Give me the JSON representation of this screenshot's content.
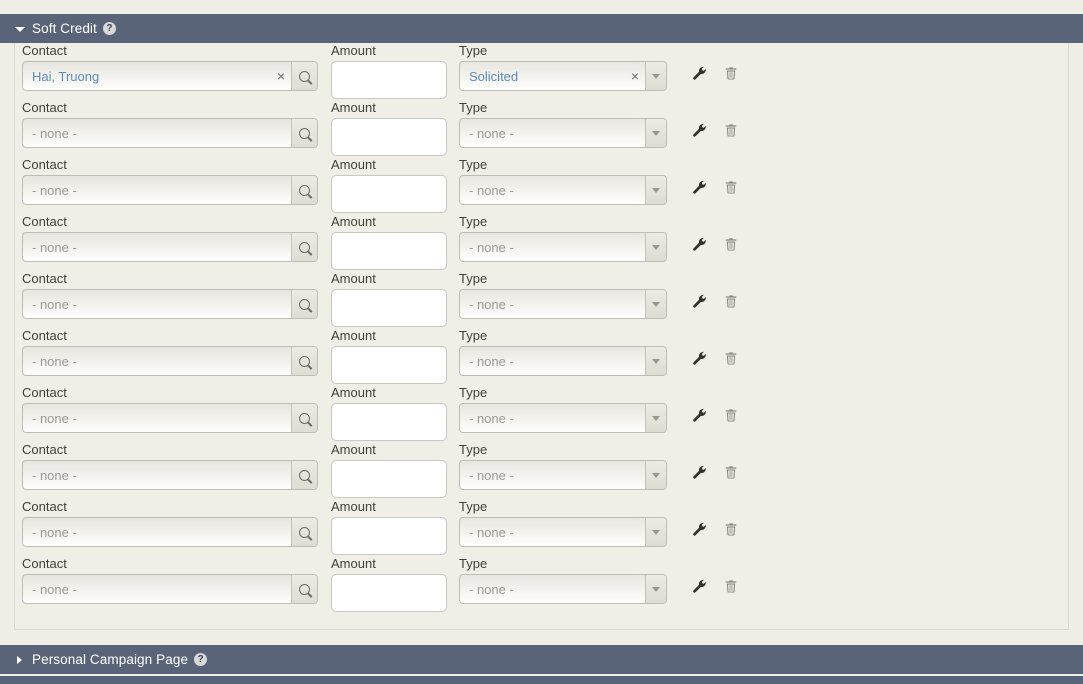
{
  "sections": {
    "soft_credit": {
      "title": "Soft Credit",
      "help": "?",
      "expanded": true
    },
    "personal_campaign_page": {
      "title": "Personal Campaign Page",
      "help": "?",
      "expanded": false
    }
  },
  "labels": {
    "contact": "Contact",
    "amount": "Amount",
    "type": "Type"
  },
  "placeholders": {
    "none": "- none -",
    "amount": ""
  },
  "icons": {
    "clear": "×",
    "search": "search-icon",
    "wrench": "wrench-icon",
    "trash": "trash-icon",
    "caret_down": "chevron-down-icon",
    "caret_right": "chevron-right-icon"
  },
  "colors": {
    "header_bar": "#5a6478",
    "page_background": "#efeee6",
    "panel_background": "#f0efe7",
    "link_text": "#5b8db8",
    "placeholder_text": "#9b9a94"
  },
  "rows": [
    {
      "contact": "Hai, Truong",
      "contact_filled": true,
      "amount": "",
      "type": "Solicited",
      "type_filled": true
    },
    {
      "contact": "- none -",
      "contact_filled": false,
      "amount": "",
      "type": "- none -",
      "type_filled": false
    },
    {
      "contact": "- none -",
      "contact_filled": false,
      "amount": "",
      "type": "- none -",
      "type_filled": false
    },
    {
      "contact": "- none -",
      "contact_filled": false,
      "amount": "",
      "type": "- none -",
      "type_filled": false
    },
    {
      "contact": "- none -",
      "contact_filled": false,
      "amount": "",
      "type": "- none -",
      "type_filled": false
    },
    {
      "contact": "- none -",
      "contact_filled": false,
      "amount": "",
      "type": "- none -",
      "type_filled": false
    },
    {
      "contact": "- none -",
      "contact_filled": false,
      "amount": "",
      "type": "- none -",
      "type_filled": false
    },
    {
      "contact": "- none -",
      "contact_filled": false,
      "amount": "",
      "type": "- none -",
      "type_filled": false
    },
    {
      "contact": "- none -",
      "contact_filled": false,
      "amount": "",
      "type": "- none -",
      "type_filled": false
    },
    {
      "contact": "- none -",
      "contact_filled": false,
      "amount": "",
      "type": "- none -",
      "type_filled": false
    }
  ]
}
